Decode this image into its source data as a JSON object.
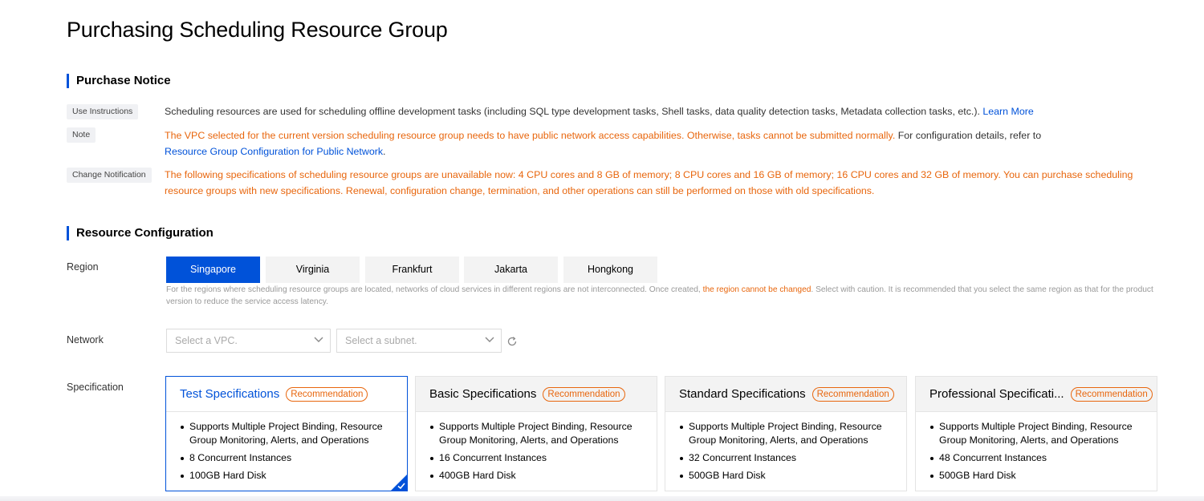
{
  "page": {
    "title": "Purchasing Scheduling Resource Group"
  },
  "notice": {
    "section_title": "Purchase Notice",
    "use_instructions": {
      "tag": "Use Instructions",
      "text": "Scheduling resources are used for scheduling offline development tasks (including SQL type development tasks, Shell tasks, data quality detection tasks, Metadata collection tasks, etc.).",
      "link": "Learn More"
    },
    "note": {
      "tag": "Note",
      "warning": "The VPC selected for the current version scheduling resource group needs to have public network access capabilities. Otherwise, tasks cannot be submitted normally.",
      "text": "For configuration details, refer to",
      "link": "Resource Group Configuration for Public Network",
      "tail": "."
    },
    "change_notification": {
      "tag": "Change Notification",
      "text": "The following specifications of scheduling resource groups are unavailable now: 4 CPU cores and 8 GB of memory; 8 CPU cores and 16 GB of memory; 16 CPU cores and 32 GB of memory. You can purchase scheduling resource groups with new specifications. Renewal, configuration change, termination, and other operations can still be performed on those with old specifications."
    }
  },
  "config": {
    "section_title": "Resource Configuration",
    "region": {
      "label": "Region",
      "options": [
        "Singapore",
        "Virginia",
        "Frankfurt",
        "Jakarta",
        "Hongkong"
      ],
      "selected": "Singapore",
      "hint_before": "For the regions where scheduling resource groups are located, networks of cloud services in different regions are not interconnected. Once created,",
      "hint_warning": "the region cannot be changed",
      "hint_after": ". Select with caution. It is recommended that you select the same region as that for the product version to reduce the service access latency."
    },
    "network": {
      "label": "Network",
      "vpc_placeholder": "Select a VPC.",
      "subnet_placeholder": "Select a subnet."
    },
    "specification": {
      "label": "Specification",
      "badge": "Recommendation",
      "cards": [
        {
          "name": "Test Specifications",
          "features": [
            "Supports Multiple Project Binding, Resource Group Monitoring, Alerts, and Operations",
            "8 Concurrent Instances",
            "100GB Hard Disk"
          ]
        },
        {
          "name": "Basic Specifications",
          "features": [
            "Supports Multiple Project Binding, Resource Group Monitoring, Alerts, and Operations",
            "16 Concurrent Instances",
            "400GB Hard Disk"
          ]
        },
        {
          "name": "Standard Specifications",
          "features": [
            "Supports Multiple Project Binding, Resource Group Monitoring, Alerts, and Operations",
            "32 Concurrent Instances",
            "500GB Hard Disk"
          ]
        },
        {
          "name": "Professional Specificati...",
          "features": [
            "Supports Multiple Project Binding, Resource Group Monitoring, Alerts, and Operations",
            "48 Concurrent Instances",
            "500GB Hard Disk"
          ]
        }
      ]
    }
  },
  "colors": {
    "accent": "#0052d9",
    "warning": "#e8660d"
  },
  "icons": {
    "select_arrow": "chevron-down-icon",
    "refresh": "refresh-icon",
    "selected_mark": "checkmark-icon"
  }
}
